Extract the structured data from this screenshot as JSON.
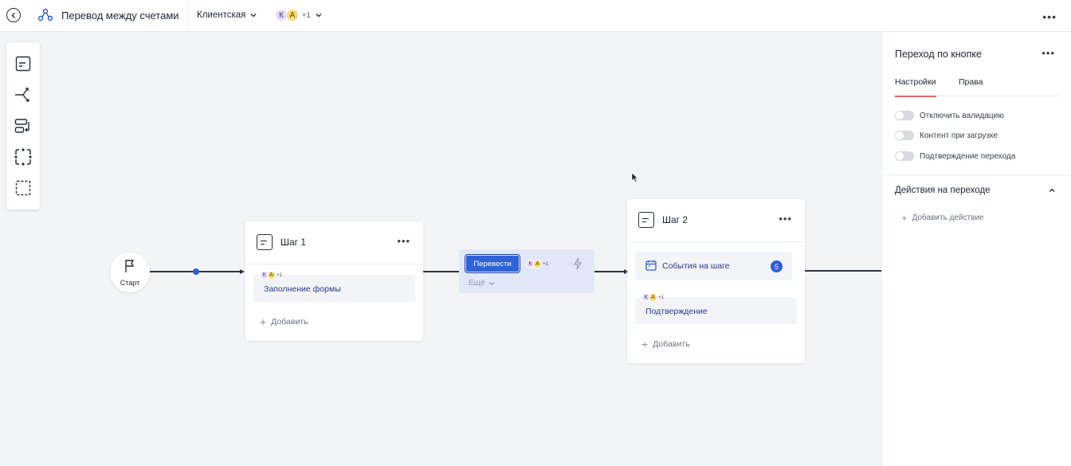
{
  "header": {
    "title": "Перевод между счетами",
    "env_label": "Клиентская",
    "avatars": [
      "К",
      "А"
    ],
    "avatars_more": "+1"
  },
  "toolbar": {
    "tools": [
      "step-icon",
      "branch-icon",
      "transition-icon",
      "group-icon",
      "selection-icon"
    ]
  },
  "canvas": {
    "start_label": "Старт",
    "step1": {
      "title": "Шаг 1",
      "item": {
        "avatars": [
          "К",
          "А"
        ],
        "avatars_more": "+1",
        "label": "Заполнение формы"
      },
      "add_label": "Добавить"
    },
    "transition": {
      "button_label": "Перевести",
      "avatars": [
        "К",
        "А"
      ],
      "avatars_more": "+1",
      "more_label": "Ещё"
    },
    "step2": {
      "title": "Шаг 2",
      "events_label": "События на шаге",
      "events_count": "5",
      "item": {
        "avatars": [
          "К",
          "А"
        ],
        "avatars_more": "+1",
        "label": "Подтверждение"
      },
      "add_label": "Добавить"
    }
  },
  "panel": {
    "title": "Переход по кнопке",
    "tabs": [
      "Настройки",
      "Права"
    ],
    "active_tab": "Настройки",
    "toggles": [
      {
        "label": "Отключить валидацию",
        "on": false
      },
      {
        "label": "Контент при загрузке",
        "on": false
      },
      {
        "label": "Подтверждение перехода",
        "on": false
      }
    ],
    "section_title": "Действия на переходе",
    "add_action_label": "Добавить действие"
  },
  "colors": {
    "accent": "#2f62d6",
    "tab_underline": "#e26a6a",
    "canvas_bg": "#f3f4f6"
  }
}
